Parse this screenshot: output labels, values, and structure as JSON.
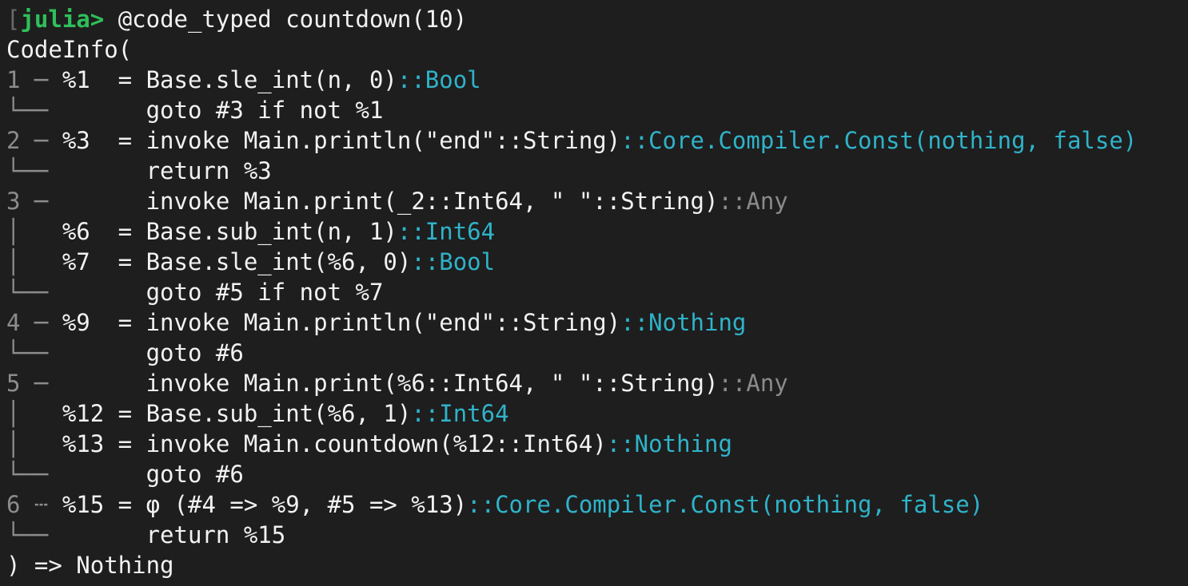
{
  "prompt": {
    "bracket": "[",
    "word": "julia>",
    "command": " @code_typed countdown(10)"
  },
  "lines": [
    {
      "gutter": "",
      "code": "CodeInfo(",
      "type": "",
      "type_color": ""
    },
    {
      "gutter": "1 ─ ",
      "code": "%1  = Base.sle_int(n, 0)",
      "type": "::Bool",
      "type_color": "cyan"
    },
    {
      "gutter": "└── ",
      "code": "      goto #3 if not %1",
      "type": "",
      "type_color": ""
    },
    {
      "gutter": "2 ─ ",
      "code": "%3  = invoke Main.println(\"end\"::String)",
      "type": "::Core.Compiler.Const(nothing, false)",
      "type_color": "cyan"
    },
    {
      "gutter": "└── ",
      "code": "      return %3",
      "type": "",
      "type_color": ""
    },
    {
      "gutter": "3 ─ ",
      "code": "      invoke Main.print(_2::Int64, \" \"::String)",
      "type": "::Any",
      "type_color": "gray"
    },
    {
      "gutter": "│   ",
      "code": "%6  = Base.sub_int(n, 1)",
      "type": "::Int64",
      "type_color": "cyan"
    },
    {
      "gutter": "│   ",
      "code": "%7  = Base.sle_int(%6, 0)",
      "type": "::Bool",
      "type_color": "cyan"
    },
    {
      "gutter": "└── ",
      "code": "      goto #5 if not %7",
      "type": "",
      "type_color": ""
    },
    {
      "gutter": "4 ─ ",
      "code": "%9  = invoke Main.println(\"end\"::String)",
      "type": "::Nothing",
      "type_color": "cyan"
    },
    {
      "gutter": "└── ",
      "code": "      goto #6",
      "type": "",
      "type_color": ""
    },
    {
      "gutter": "5 ─ ",
      "code": "      invoke Main.print(%6::Int64, \" \"::String)",
      "type": "::Any",
      "type_color": "gray"
    },
    {
      "gutter": "│   ",
      "code": "%12 = Base.sub_int(%6, 1)",
      "type": "::Int64",
      "type_color": "cyan"
    },
    {
      "gutter": "│   ",
      "code": "%13 = invoke Main.countdown(%12::Int64)",
      "type": "::Nothing",
      "type_color": "cyan"
    },
    {
      "gutter": "└── ",
      "code": "      goto #6",
      "type": "",
      "type_color": ""
    },
    {
      "gutter": "6 ┄ ",
      "code": "%15 = φ (#4 => %9, #5 => %13)",
      "type": "::Core.Compiler.Const(nothing, false)",
      "type_color": "cyan"
    },
    {
      "gutter": "└── ",
      "code": "      return %15",
      "type": "",
      "type_color": ""
    },
    {
      "gutter": "",
      "code": ") => Nothing",
      "type": "",
      "type_color": ""
    }
  ],
  "colors": {
    "background": "#1e1e1e",
    "text": "#f2f2f2",
    "prompt": "#2ec05a",
    "type_cyan": "#2fb3c9",
    "type_gray": "#8a8a8a",
    "gutter": "#8c8c8c"
  }
}
